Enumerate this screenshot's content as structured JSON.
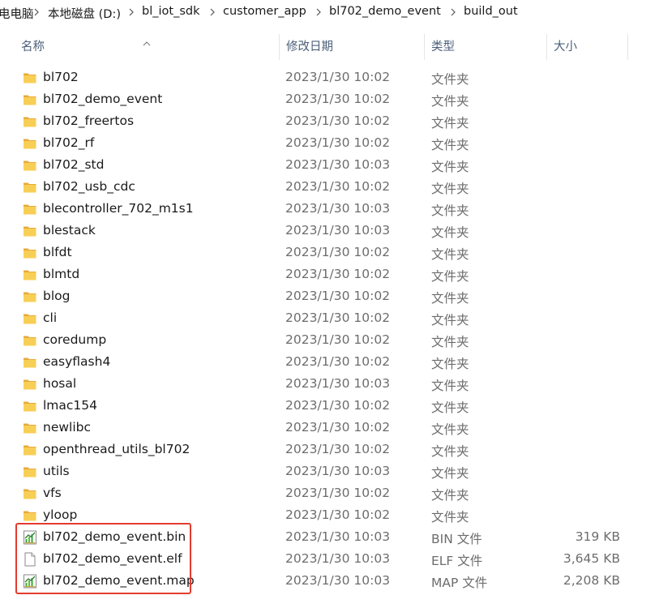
{
  "breadcrumb": [
    "电电脑",
    "本地磁盘 (D:)",
    "bl_iot_sdk",
    "customer_app",
    "bl702_demo_event",
    "build_out"
  ],
  "columns": {
    "name": "名称",
    "date": "修改日期",
    "type": "类型",
    "size": "大小"
  },
  "sort": {
    "column": "name",
    "direction": "ascending"
  },
  "rows": [
    {
      "name": "bl702",
      "date": "2023/1/30 10:02",
      "type": "文件夹",
      "size": "",
      "icon": "folder-icon"
    },
    {
      "name": "bl702_demo_event",
      "date": "2023/1/30 10:02",
      "type": "文件夹",
      "size": "",
      "icon": "folder-icon"
    },
    {
      "name": "bl702_freertos",
      "date": "2023/1/30 10:02",
      "type": "文件夹",
      "size": "",
      "icon": "folder-icon"
    },
    {
      "name": "bl702_rf",
      "date": "2023/1/30 10:02",
      "type": "文件夹",
      "size": "",
      "icon": "folder-icon"
    },
    {
      "name": "bl702_std",
      "date": "2023/1/30 10:03",
      "type": "文件夹",
      "size": "",
      "icon": "folder-icon"
    },
    {
      "name": "bl702_usb_cdc",
      "date": "2023/1/30 10:02",
      "type": "文件夹",
      "size": "",
      "icon": "folder-icon"
    },
    {
      "name": "blecontroller_702_m1s1",
      "date": "2023/1/30 10:03",
      "type": "文件夹",
      "size": "",
      "icon": "folder-icon"
    },
    {
      "name": "blestack",
      "date": "2023/1/30 10:03",
      "type": "文件夹",
      "size": "",
      "icon": "folder-icon"
    },
    {
      "name": "blfdt",
      "date": "2023/1/30 10:02",
      "type": "文件夹",
      "size": "",
      "icon": "folder-icon"
    },
    {
      "name": "blmtd",
      "date": "2023/1/30 10:02",
      "type": "文件夹",
      "size": "",
      "icon": "folder-icon"
    },
    {
      "name": "blog",
      "date": "2023/1/30 10:02",
      "type": "文件夹",
      "size": "",
      "icon": "folder-icon"
    },
    {
      "name": "cli",
      "date": "2023/1/30 10:02",
      "type": "文件夹",
      "size": "",
      "icon": "folder-icon"
    },
    {
      "name": "coredump",
      "date": "2023/1/30 10:02",
      "type": "文件夹",
      "size": "",
      "icon": "folder-icon"
    },
    {
      "name": "easyflash4",
      "date": "2023/1/30 10:02",
      "type": "文件夹",
      "size": "",
      "icon": "folder-icon"
    },
    {
      "name": "hosal",
      "date": "2023/1/30 10:03",
      "type": "文件夹",
      "size": "",
      "icon": "folder-icon"
    },
    {
      "name": "lmac154",
      "date": "2023/1/30 10:02",
      "type": "文件夹",
      "size": "",
      "icon": "folder-icon"
    },
    {
      "name": "newlibc",
      "date": "2023/1/30 10:02",
      "type": "文件夹",
      "size": "",
      "icon": "folder-icon"
    },
    {
      "name": "openthread_utils_bl702",
      "date": "2023/1/30 10:02",
      "type": "文件夹",
      "size": "",
      "icon": "folder-icon"
    },
    {
      "name": "utils",
      "date": "2023/1/30 10:03",
      "type": "文件夹",
      "size": "",
      "icon": "folder-icon"
    },
    {
      "name": "vfs",
      "date": "2023/1/30 10:02",
      "type": "文件夹",
      "size": "",
      "icon": "folder-icon"
    },
    {
      "name": "yloop",
      "date": "2023/1/30 10:02",
      "type": "文件夹",
      "size": "",
      "icon": "folder-icon"
    },
    {
      "name": "bl702_demo_event.bin",
      "date": "2023/1/30 10:03",
      "type": "BIN 文件",
      "size": "319 KB",
      "icon": "chart-file-icon"
    },
    {
      "name": "bl702_demo_event.elf",
      "date": "2023/1/30 10:03",
      "type": "ELF 文件",
      "size": "3,645 KB",
      "icon": "blank-file-icon"
    },
    {
      "name": "bl702_demo_event.map",
      "date": "2023/1/30 10:03",
      "type": "MAP 文件",
      "size": "2,208 KB",
      "icon": "chart-file-icon"
    }
  ],
  "highlight_color": "#e33b2e",
  "folder_color": "#f5c242"
}
